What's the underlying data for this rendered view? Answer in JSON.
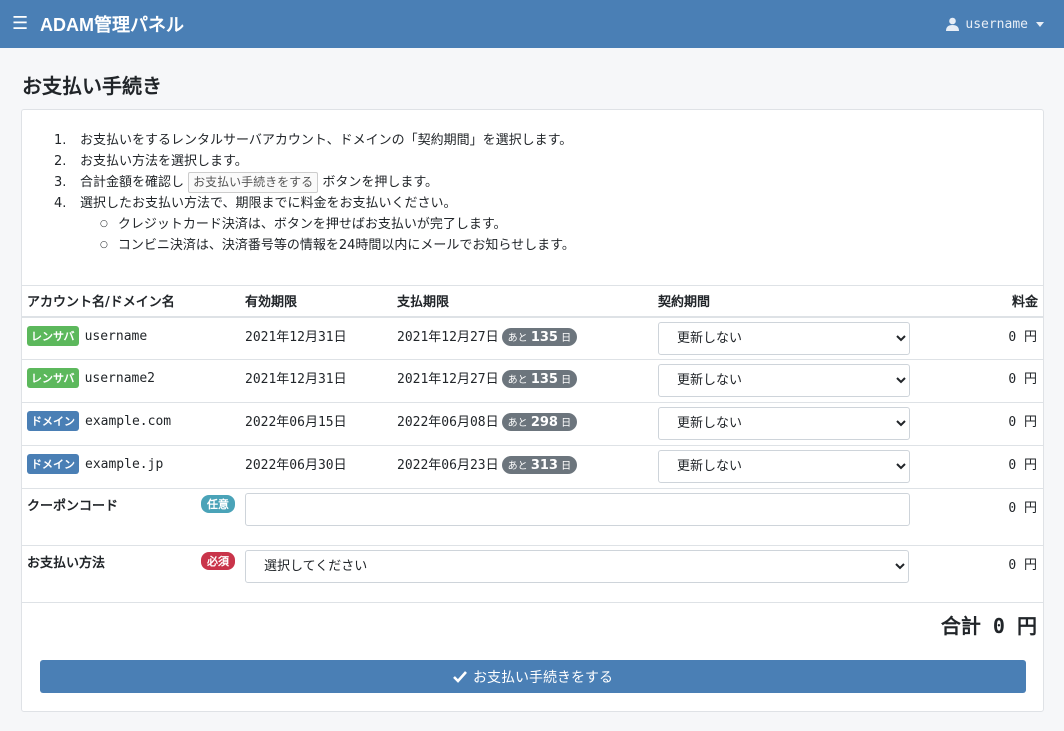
{
  "navbar": {
    "title": "ADAM管理パネル",
    "menu_icon": "☰",
    "user_icon": "user-icon",
    "username": "username"
  },
  "page": {
    "title": "お支払い手続き"
  },
  "steps": [
    {
      "num": "1.",
      "text": "お支払いをするレンタルサーバアカウント、ドメインの「契約期間」を選択します。"
    },
    {
      "num": "2.",
      "text": "お支払い方法を選択します。"
    },
    {
      "num": "3.",
      "pre": "合計金額を確認し",
      "button": "お支払い手続きをする",
      "post": "ボタンを押します。"
    },
    {
      "num": "4.",
      "text": "選択したお支払い方法で、期限までに料金をお支払いください。"
    }
  ],
  "substeps": [
    "クレジットカード決済は、ボタンを押せばお支払いが完了します。",
    "コンビニ決済は、決済番号等の情報を24時間以内にメールでお知らせします。"
  ],
  "table": {
    "headers": [
      "アカウント名/ドメイン名",
      "有効期限",
      "支払期限",
      "契約期間",
      "料金"
    ],
    "rows": [
      {
        "type": "レンサバ",
        "type_color": "#5cb85c",
        "name": "username",
        "expiry": "2021年12月31日",
        "due": "2021年12月27日",
        "remain_pre": "あと",
        "remain": "135",
        "remain_post": "日",
        "period": "更新しない",
        "fee": "0 円"
      },
      {
        "type": "レンサバ",
        "type_color": "#5cb85c",
        "name": "username2",
        "expiry": "2021年12月31日",
        "due": "2021年12月27日",
        "remain_pre": "あと",
        "remain": "135",
        "remain_post": "日",
        "period": "更新しない",
        "fee": "0 円"
      },
      {
        "type": "ドメイン",
        "type_color": "#4a7fb5",
        "name": "example.com",
        "expiry": "2022年06月15日",
        "due": "2022年06月08日",
        "remain_pre": "あと",
        "remain": "298",
        "remain_post": "日",
        "period": "更新しない",
        "fee": "0 円"
      },
      {
        "type": "ドメイン",
        "type_color": "#4a7fb5",
        "name": "example.jp",
        "expiry": "2022年06月30日",
        "due": "2022年06月23日",
        "remain_pre": "あと",
        "remain": "313",
        "remain_post": "日",
        "period": "更新しない",
        "fee": "0 円"
      }
    ]
  },
  "coupon": {
    "label": "クーポンコード",
    "badge": "任意",
    "badge_color": "#4aa3b8",
    "value": "",
    "fee": "0 円"
  },
  "payment": {
    "label": "お支払い方法",
    "badge": "必須",
    "badge_color": "#c9344a",
    "selected": "選択してください",
    "fee": "0 円"
  },
  "total": {
    "label": "合計",
    "amount": "0",
    "unit": "円"
  },
  "submit": {
    "label": "お支払い手続きをする"
  }
}
